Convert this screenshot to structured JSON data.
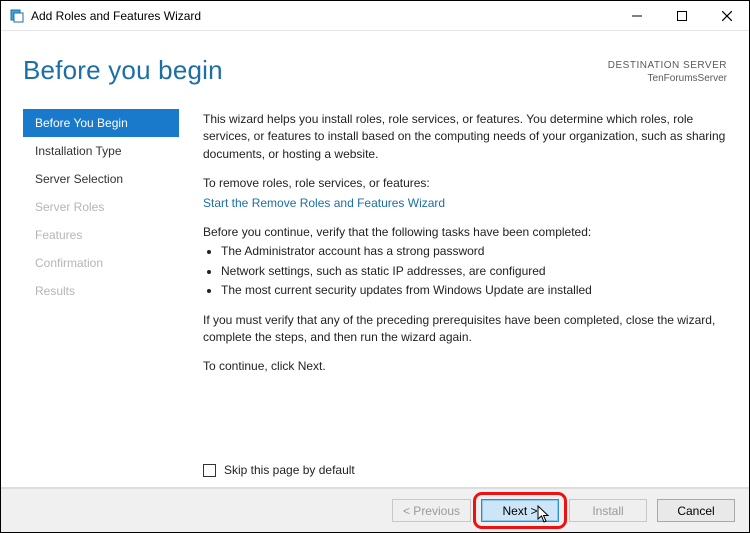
{
  "window": {
    "title": "Add Roles and Features Wizard"
  },
  "header": {
    "page_title": "Before you begin",
    "destination_label": "DESTINATION SERVER",
    "destination_value": "TenForumsServer"
  },
  "sidebar": {
    "items": [
      {
        "label": "Before You Begin",
        "state": "active"
      },
      {
        "label": "Installation Type",
        "state": "normal"
      },
      {
        "label": "Server Selection",
        "state": "normal"
      },
      {
        "label": "Server Roles",
        "state": "disabled"
      },
      {
        "label": "Features",
        "state": "disabled"
      },
      {
        "label": "Confirmation",
        "state": "disabled"
      },
      {
        "label": "Results",
        "state": "disabled"
      }
    ]
  },
  "content": {
    "intro": "This wizard helps you install roles, role services, or features. You determine which roles, role services, or features to install based on the computing needs of your organization, such as sharing documents, or hosting a website.",
    "remove_label": "To remove roles, role services, or features:",
    "remove_link": "Start the Remove Roles and Features Wizard",
    "verify_intro": "Before you continue, verify that the following tasks have been completed:",
    "bullets": [
      "The Administrator account has a strong password",
      "Network settings, such as static IP addresses, are configured",
      "The most current security updates from Windows Update are installed"
    ],
    "verify_close": "If you must verify that any of the preceding prerequisites have been completed, close the wizard, complete the steps, and then run the wizard again.",
    "continue": "To continue, click Next.",
    "skip_label": "Skip this page by default"
  },
  "footer": {
    "previous": "< Previous",
    "next": "Next >",
    "install": "Install",
    "cancel": "Cancel"
  }
}
